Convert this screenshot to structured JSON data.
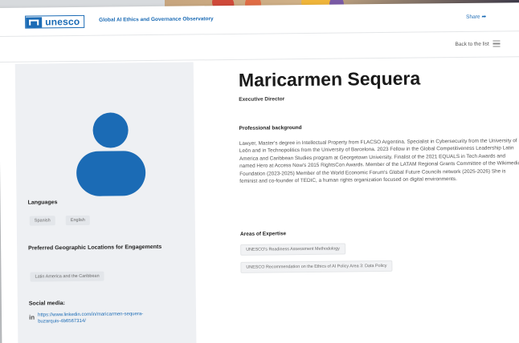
{
  "header": {
    "logo_text": "unesco",
    "site_title": "Global AI Ethics and Governance Observatory",
    "share_label": "Share",
    "share_icon": "arrow-icon"
  },
  "subbar": {
    "back_label": "Back to the list",
    "list_icon": "list-icon"
  },
  "profile": {
    "name": "Maricarmen Sequera",
    "role": "Executive Director",
    "background_heading": "Professional background",
    "background_text": "Lawyer, Master's degree in Intellectual Property from FLACSO Argentina. Specialist in Cybersecurity from the University of León and in Technopolitics from the University of Barcelona. 2023 Fellow in the Global Competitiveness Leadership Latin America and Caribbean Studies program at Georgetown University. Finalist of the 2021 EQUALS in Tech Awards and named Hero at Access Now's 2015 RightsCon Awards. Member of the LATAM Regional Grants Committee of the Wikimedia Foundation (2023-2025) Member of the World Economic Forum's Global Future Councils network (2025-2026) She is feminist and co-founder of TEDIC, a human rights organization focused on digital environments.",
    "expertise_heading": "Areas of Expertise",
    "expertise": [
      "UNESCO's Readiness Assessment Methodology",
      "UNESCO Recommendation on the Ethics of AI Policy Area 3: Data Policy"
    ]
  },
  "sidebar": {
    "languages_label": "Languages",
    "languages": [
      "Spanish",
      "English"
    ],
    "geo_label": "Preferred Geographic Locations for Engagements",
    "geo": [
      "Latin America and the Caribbean"
    ],
    "social_label": "Social media:",
    "social_icon": "linkedin-icon",
    "social_link": "https://www.linkedin.com/in/maricarmen-sequera-buzarquis-4b6567314/"
  },
  "colors": {
    "brand_blue": "#1b6bb5",
    "sidebar_bg": "#eef0f3"
  }
}
